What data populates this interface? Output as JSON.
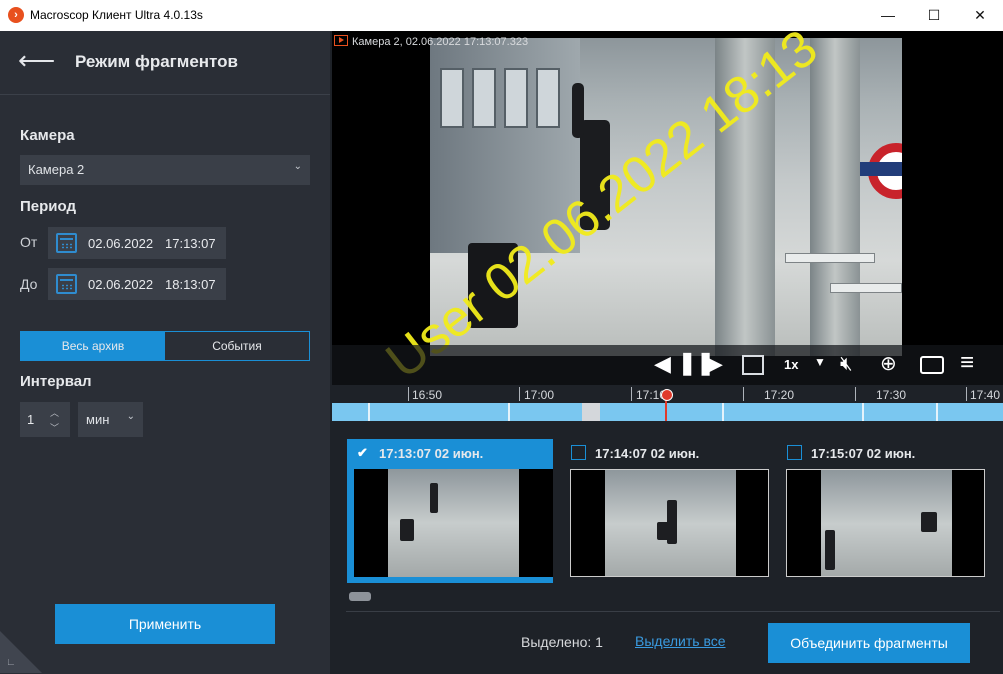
{
  "window": {
    "title": "Macroscop Клиент Ultra 4.0.13s",
    "minimize": "—",
    "maximize": "☐",
    "close": "✕"
  },
  "sidebar": {
    "title": "Режим фрагментов",
    "camera_label": "Камера",
    "camera_value": "Камера 2",
    "period_label": "Период",
    "from_label": "От",
    "from_date": "02.06.2022",
    "from_time": "17:13:07",
    "to_label": "До",
    "to_date": "02.06.2022",
    "to_time": "18:13:07",
    "tabs": [
      "Весь архив",
      "События"
    ],
    "active_tab": "Весь архив",
    "interval_label": "Интервал",
    "interval_value": "1",
    "interval_unit": "мин",
    "apply_label": "Применить"
  },
  "video": {
    "camera_title": "Камера 2, 02.06.2022 17:13:07.323",
    "watermark": "User 02.06.2022 18:13",
    "speed": "1x"
  },
  "timeline": {
    "ticks": [
      "16:50",
      "17:00",
      "17:10",
      "17:20",
      "17:30",
      "17:40"
    ]
  },
  "fragments": {
    "items": [
      {
        "label": "17:13:07 02 июн.",
        "selected": true
      },
      {
        "label": "17:14:07 02 июн.",
        "selected": false
      },
      {
        "label": "17:15:07 02 июн.",
        "selected": false
      }
    ],
    "selected_count": "Выделено: 1",
    "select_all": "Выделить все",
    "merge_label": "Объединить фрагменты"
  },
  "colors": {
    "accent": "#1a8fd6",
    "panel": "#2a2e36",
    "background": "#1e2228",
    "timeline": "#7ac7f0",
    "playhead": "#e03a2b",
    "watermark": "#f2ec1b"
  },
  "icons": [
    "app-logo-icon",
    "back-arrow-icon",
    "chevron-down-icon",
    "calendar-icon",
    "prev-frame-icon",
    "pause-icon",
    "next-frame-icon",
    "speed-chevron-icon",
    "mute-icon",
    "zoom-in-icon",
    "snapshot-icon",
    "menu-icon",
    "checkbox-icon"
  ]
}
